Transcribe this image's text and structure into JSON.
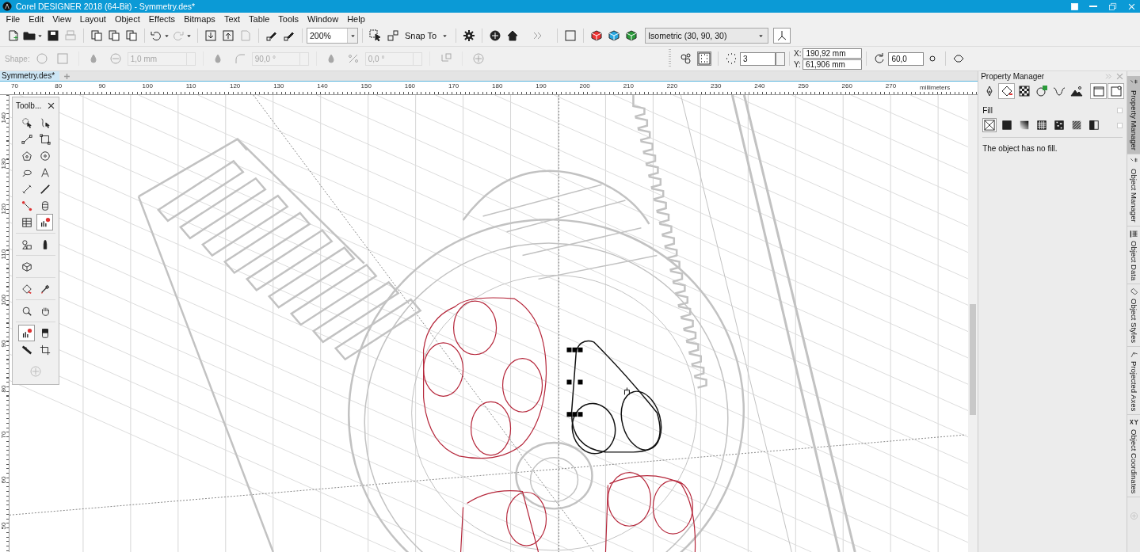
{
  "window": {
    "title": "Corel DESIGNER 2018 (64-Bit) - Symmetry.des*"
  },
  "menu": [
    "File",
    "Edit",
    "View",
    "Layout",
    "Object",
    "Effects",
    "Bitmaps",
    "Text",
    "Table",
    "Tools",
    "Window",
    "Help"
  ],
  "standard_toolbar": {
    "buttons": [
      {
        "disabled": false
      },
      {
        "disabled": false
      },
      {
        "disabled": false
      },
      {
        "disabled": true
      },
      {
        "disabled": false
      },
      {
        "disabled": false
      },
      {
        "disabled": false
      },
      {
        "disabled": false
      },
      {
        "disabled": true
      },
      {
        "disabled": false
      },
      {
        "disabled": false
      },
      {
        "disabled": true
      },
      {
        "disabled": false
      },
      {
        "disabled": false
      }
    ],
    "zoom": "200%",
    "snap_to": "Snap To",
    "projection": "Isometric (30, 90, 30)"
  },
  "property_bar": {
    "disabled": true,
    "shape_label": "Shape:",
    "fields": [
      "1,0 mm",
      "90,0 °",
      "0,0 °"
    ],
    "count": "3",
    "x_label": "X:",
    "x_value": "190,92 mm",
    "y_label": "Y:",
    "y_value": "61,906 mm",
    "angle": "60,0"
  },
  "document_tab": "Symmetry.des*",
  "top_ruler": {
    "labels": [
      "70",
      "80",
      "90",
      "100",
      "110",
      "120",
      "130",
      "140",
      "150",
      "160",
      "170",
      "180",
      "190",
      "200",
      "210",
      "220",
      "230",
      "240",
      "250",
      "260",
      "270"
    ],
    "unit": "millimeters"
  },
  "left_ruler": {
    "labels": [
      "140",
      "130",
      "120",
      "110",
      "100",
      "90",
      "80",
      "70",
      "60",
      "50"
    ]
  },
  "toolbox": {
    "title": "Toolb...",
    "groups": [
      {
        "tools": [
          {
            "selected": false
          },
          {
            "selected": false
          },
          {
            "selected": false
          },
          {
            "selected": false
          },
          {
            "selected": false
          },
          {
            "selected": false
          },
          {
            "selected": false
          },
          {
            "selected": false
          },
          {
            "selected": false
          },
          {
            "selected": false
          },
          {
            "selected": false
          },
          {
            "selected": false
          },
          {
            "selected": false
          },
          {
            "selected": true
          }
        ]
      },
      {
        "tools": [
          {
            "selected": false
          },
          {
            "selected": false
          }
        ]
      },
      {
        "tools": [
          {
            "selected": false
          }
        ]
      },
      {
        "tools": [
          {
            "selected": false
          },
          {
            "selected": false
          }
        ]
      },
      {
        "tools": [
          {
            "selected": false
          },
          {
            "selected": false
          }
        ]
      },
      {
        "tools": [
          {
            "selected": true
          },
          {
            "selected": false
          },
          {
            "selected": false
          },
          {
            "selected": false
          }
        ]
      }
    ]
  },
  "property_manager": {
    "title": "Property Manager",
    "tabs": [
      {
        "selected": false
      },
      {
        "selected": true
      },
      {
        "selected": false
      },
      {
        "selected": false
      },
      {
        "selected": false
      },
      {
        "selected": false
      }
    ],
    "fill_label": "Fill",
    "options": [
      {
        "checked": false
      },
      {
        "checked": false
      }
    ],
    "fill_types": [
      {
        "selected": true
      },
      {
        "selected": false
      },
      {
        "selected": false
      },
      {
        "selected": false
      },
      {
        "selected": false
      },
      {
        "selected": false
      },
      {
        "selected": false
      }
    ],
    "message": "The object has no fill."
  },
  "side_tabs": [
    {
      "label": "Property Manager",
      "selected": true
    },
    {
      "label": "Object Manager",
      "selected": false
    },
    {
      "label": "Object Data",
      "selected": false
    },
    {
      "label": "Object Styles",
      "selected": false
    },
    {
      "label": "Projected Axes",
      "selected": false
    },
    {
      "label": "Object Coordinates",
      "selected": false
    }
  ]
}
